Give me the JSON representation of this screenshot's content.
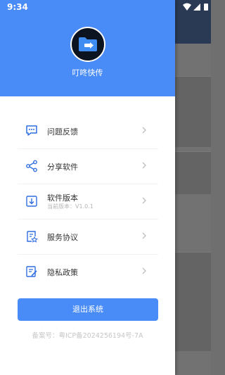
{
  "status_bar": {
    "time": "9:34"
  },
  "drawer": {
    "app_name": "叮咚快传",
    "menu": [
      {
        "label": "问题反馈",
        "icon": "feedback-icon"
      },
      {
        "label": "分享软件",
        "icon": "share-icon"
      },
      {
        "label": "软件版本",
        "sublabel": "当前版本：V1.0.1",
        "icon": "download-icon"
      },
      {
        "label": "服务协议",
        "icon": "agreement-icon"
      },
      {
        "label": "隐私政策",
        "icon": "privacy-icon"
      }
    ],
    "logout_label": "退出系统",
    "icp": "备案号：粤ICP备2024256194号-7A"
  },
  "colors": {
    "accent": "#4a8cf7",
    "icon": "#2f6fe0"
  }
}
